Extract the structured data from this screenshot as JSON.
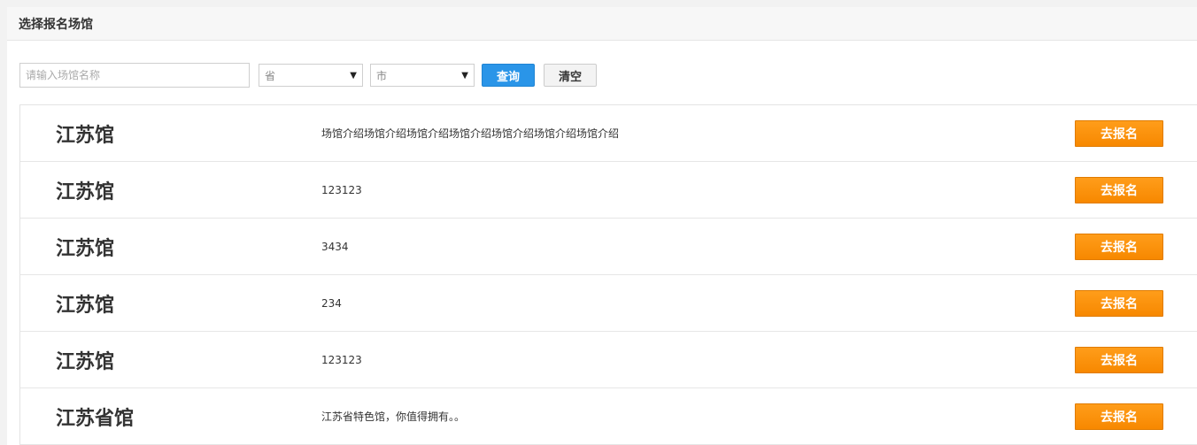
{
  "header": {
    "title": "选择报名场馆"
  },
  "filters": {
    "name_placeholder": "请输入场馆名称",
    "province_selected": "省",
    "city_selected": "市",
    "query_label": "查询",
    "clear_label": "清空"
  },
  "venues": [
    {
      "name": "江苏馆",
      "desc": "场馆介绍场馆介绍场馆介绍场馆介绍场馆介绍场馆介绍场馆介绍",
      "action": "去报名"
    },
    {
      "name": "江苏馆",
      "desc": "123123",
      "action": "去报名"
    },
    {
      "name": "江苏馆",
      "desc": "3434",
      "action": "去报名"
    },
    {
      "name": "江苏馆",
      "desc": "234",
      "action": "去报名"
    },
    {
      "name": "江苏馆",
      "desc": "123123",
      "action": "去报名"
    },
    {
      "name": "江苏省馆",
      "desc": "江苏省特色馆，你值得拥有。。",
      "action": "去报名"
    }
  ],
  "colors": {
    "primary": "#2a95e8",
    "accent": "#f78800"
  }
}
